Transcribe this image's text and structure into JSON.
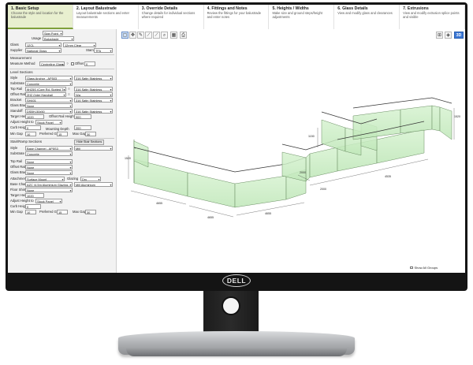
{
  "steps": [
    {
      "title": "1. Basic Setup",
      "desc": "Choose the style and location for the balustrade"
    },
    {
      "title": "2. Layout Balustrade",
      "desc": "Layout balustrade sections and enter measurements"
    },
    {
      "title": "3. Override Details",
      "desc": "Change details for individual sections where required"
    },
    {
      "title": "4. Fittings and Notes",
      "desc": "Review the fittings for your balustrade and enter notes"
    },
    {
      "title": "5. Heights / Widths",
      "desc": "Make size and ground steps/height adjustments"
    },
    {
      "title": "6. Glass Details",
      "desc": "View and modify glass and clearances"
    },
    {
      "title": "7. Extrusions",
      "desc": "View and modify extrusion splice points and visible"
    }
  ],
  "left": {
    "top_select": "Sign Point",
    "usage_label": "Usage",
    "usage": "Balustrade",
    "glass_label": "Glass",
    "glass_a": "12CL",
    "glass_b": "12mm Clear",
    "supplier_label": "Supplier",
    "supplier": "National Glass",
    "stamp_label": "Stamp",
    "stamp": "TFA",
    "measurement_h": "Measurement",
    "measure_method_label": "Measure Method",
    "measure_method": "Centreline Glass",
    "offset_label": "Offset",
    "offset": "0",
    "level_h": "Level Sections",
    "style_label": "Style",
    "style": "Glass Anchor - AP503",
    "style_b": "316 Satin Stainless",
    "substrate_label": "Substrate",
    "substrate": "Concrete",
    "toprail_label": "Top Rail",
    "toprail": "9H25S (Core Rd. Slotted T...",
    "toprail_b": "316 Satin Stainless",
    "offsetrail_label": "Offset Rail",
    "offsetrail": "2H2 (Inter Handrail",
    "offsetrail_b": "N/a",
    "bracket_label": "Bracket",
    "bracket": "SH401",
    "bracket_b": "316 Satin Stainless",
    "glassbracket_label": "Glass Bracket",
    "glassbracket": "None",
    "standoff_label": "Standoff",
    "standoff": "DSBH-50x50",
    "standoff_b": "316 Satin Stainless",
    "targetheight_label": "Target Height",
    "targetheight": "1020",
    "offsetrailheight_label": "Offset Rail Height",
    "offsetrailheight": "900",
    "adjustheight_label": "Adjust Height to",
    "adjustheight": "Stock Panel",
    "curbheight_label": "Curb Height",
    "curbheight": "0",
    "mountingdepth_label": "Mounting Depth",
    "mountingdepth": "200",
    "mingap_label": "Min Gap",
    "mingap": "10",
    "prefgap_label": "Preferred Gap",
    "prefgap": "15",
    "maxgap_label": "Max Gap",
    "maxgap": "30",
    "stair_h": "Stair/Ramp Sections",
    "hide_stair_btn": "Hide Stair Sections",
    "s_style_label": "Style",
    "s_style": "Base Channel - AP5S3",
    "s_style_b": "Mill",
    "s_substrate_label": "Substrate",
    "s_substrate": "Concrete",
    "s_toprail_label": "Top Rail",
    "s_toprail": "None",
    "s_offsetrail_label": "Offset Rail",
    "s_offsetrail": "None",
    "s_glassbracket_label": "Glass Bracket",
    "s_glassbracket": "None",
    "s_attachment_label": "Attachment",
    "s_attachment": "Surface Mount",
    "s_glazing_label": "Glazing",
    "s_glazing": "Dry",
    "s_basechannel_label": "Base Channel",
    "s_basechannel": "AZC (4.5m Aluminium Glazing...",
    "s_basechannel_b": "Mill Aluminium",
    "s_floorshim_label": "Floor Shim",
    "s_floorshim": "None",
    "s_targetheight_label": "Target Height",
    "s_targetheight": "1020",
    "s_adjustheight_label": "Adjust Height to",
    "s_adjustheight": "Stock Panel",
    "s_curbheight_label": "Curb Height",
    "s_curbheight": "0",
    "s_mingap_label": "Min Gap",
    "s_mingap": "10",
    "s_prefgap_label": "Preferred Gap",
    "s_prefgap": "15",
    "s_maxgap_label": "Max Gap",
    "s_maxgap": "30"
  },
  "toolbar": {
    "tools": [
      "select",
      "move",
      "pen",
      "draw",
      "draw-alt",
      "zoom",
      "grid",
      "print"
    ],
    "right": [
      "layout-icon",
      "iso-icon",
      "3D"
    ]
  },
  "view": {
    "show_all_label": "Show All Groups",
    "dims": [
      "1520",
      "4655",
      "4655",
      "1550",
      "4655",
      "4535",
      "2000",
      "2000",
      "1150",
      "1520"
    ]
  },
  "monitor": {
    "brand": "DELL"
  }
}
